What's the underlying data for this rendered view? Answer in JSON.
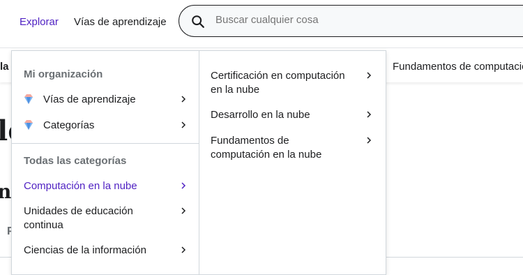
{
  "header": {
    "explore_label": "Explorar",
    "paths_label": "Vías de aprendizaje",
    "search_placeholder": "Buscar cualquier cosa"
  },
  "background": {
    "subnav_left": "la",
    "subnav_right": "Fundamentos de computació",
    "heading_fragment": "le",
    "heading2_fragment": "n c",
    "small_fragment": "P"
  },
  "menu": {
    "org_title": "Mi organización",
    "org_items": [
      {
        "label": "Vías de aprendizaje",
        "icon": "gem-icon"
      },
      {
        "label": "Categorías",
        "icon": "gem-icon"
      }
    ],
    "categories_title": "Todas las categorías",
    "categories": [
      {
        "label": "Computación en la nube",
        "active": true
      },
      {
        "label": "Unidades de educación continua"
      },
      {
        "label": "Ciencias de la información"
      }
    ],
    "subcategories": [
      {
        "label": "Certificación en computación en la nube"
      },
      {
        "label": "Desarrollo en la nube"
      },
      {
        "label": "Fundamentos de computación en la nube"
      }
    ]
  },
  "colors": {
    "accent": "#5022c3",
    "text": "#1c1d1f",
    "muted": "#6a6f73",
    "border": "#d1d7dc"
  }
}
